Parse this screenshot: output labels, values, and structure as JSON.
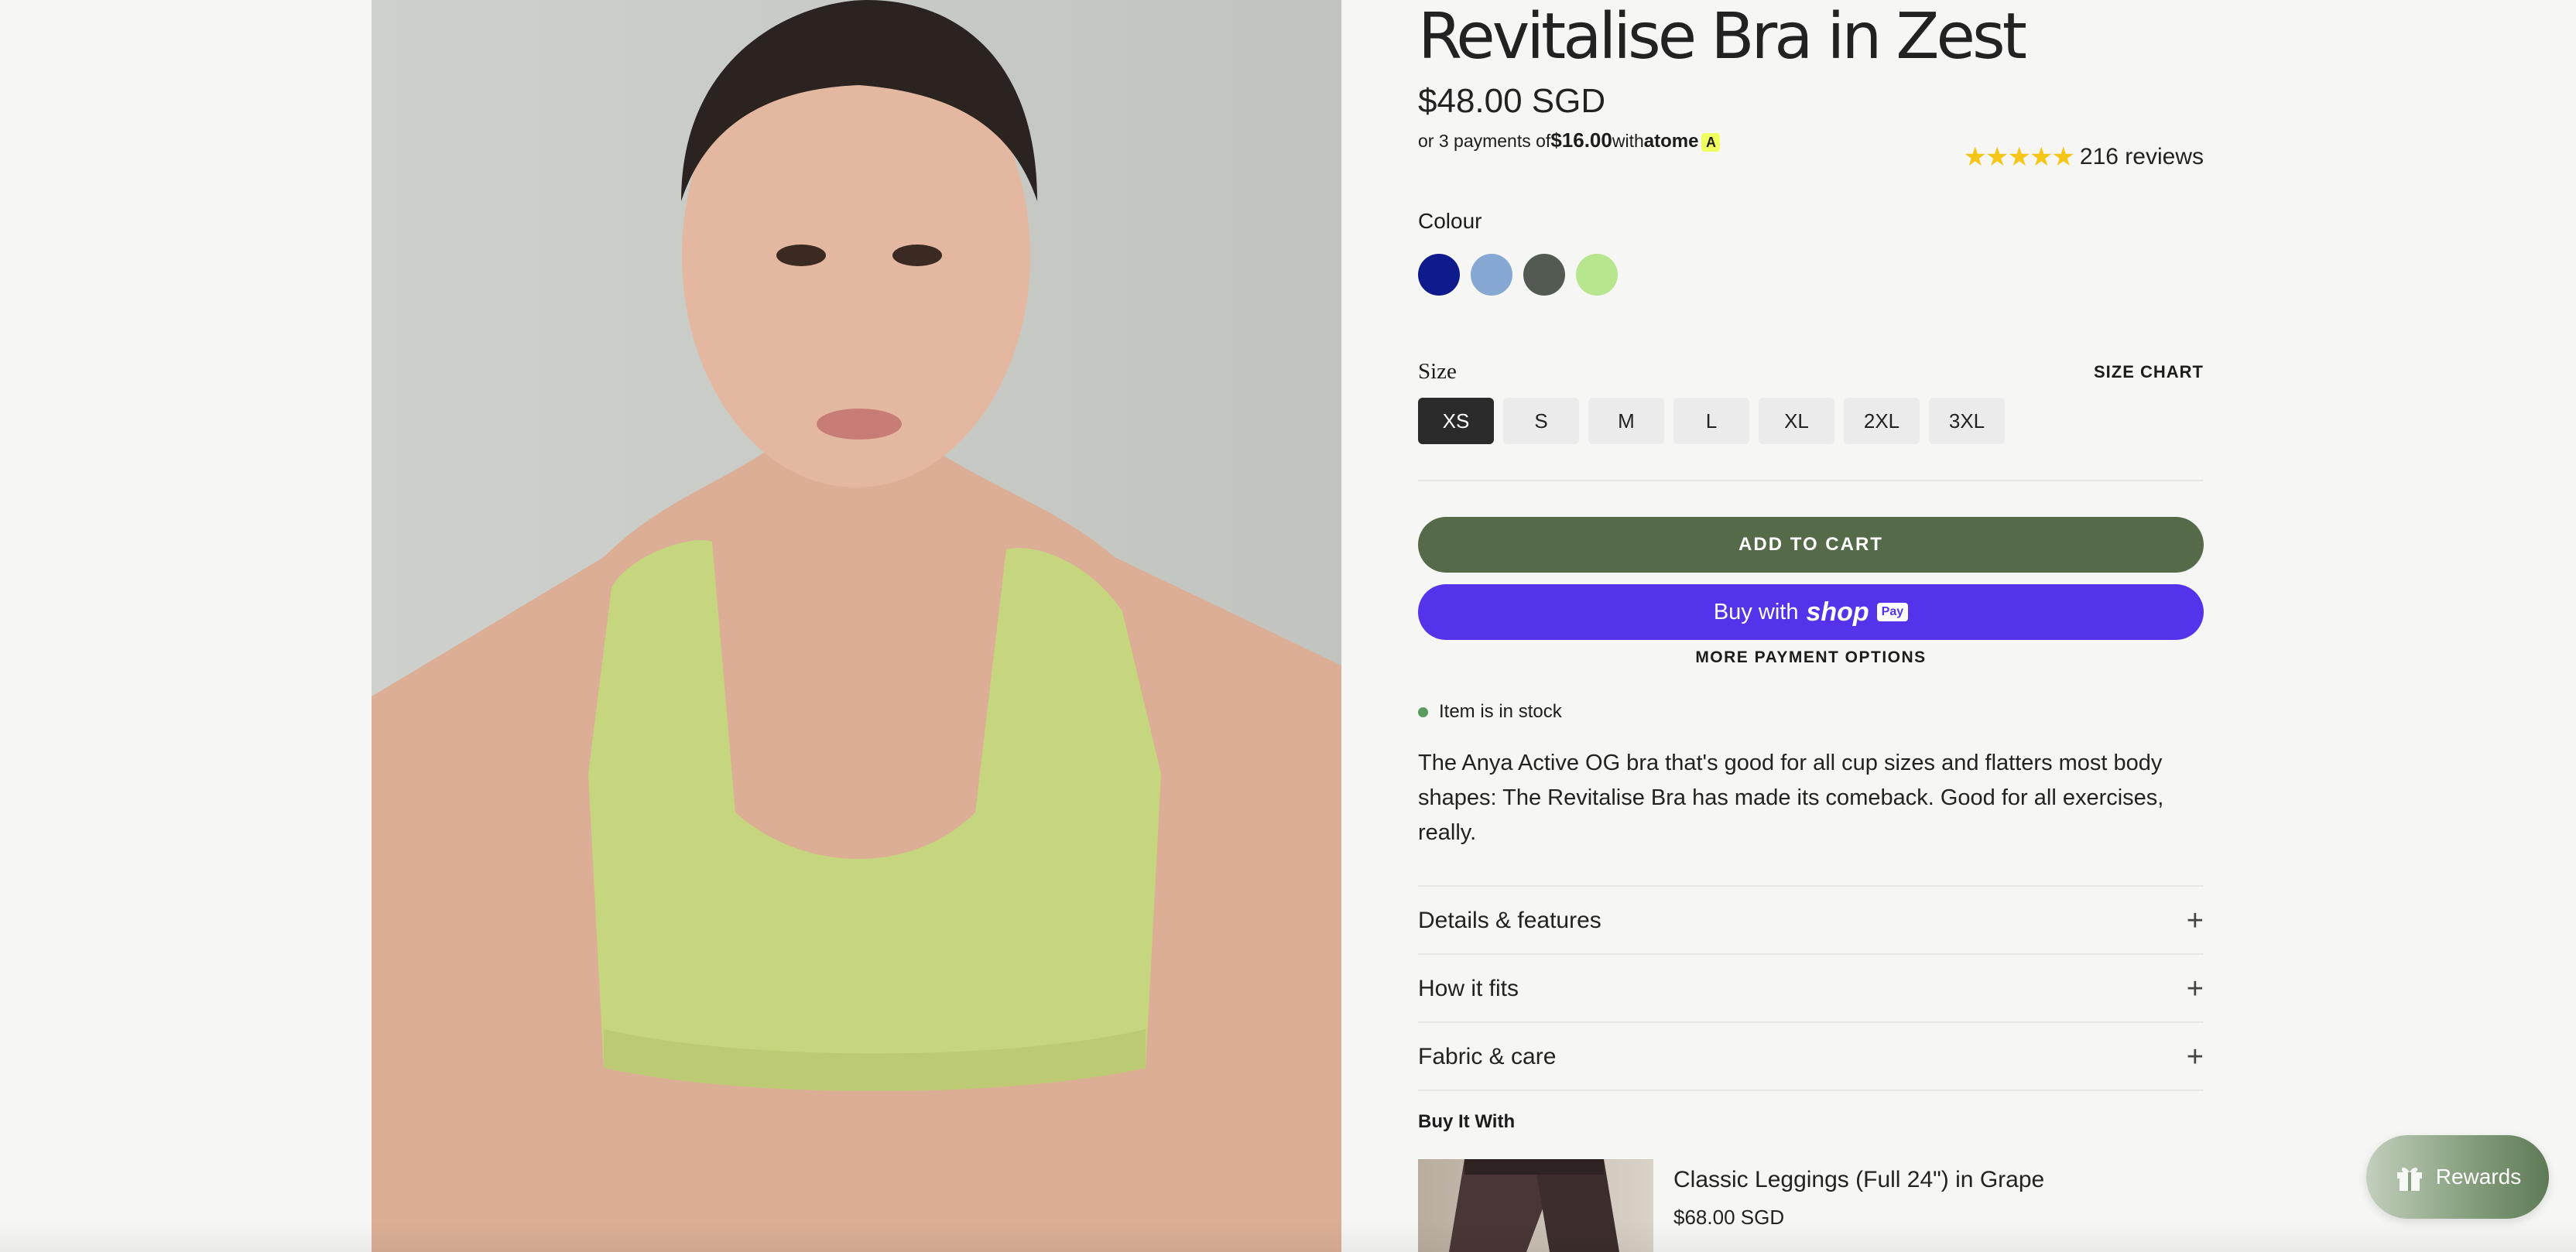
{
  "product": {
    "title": "Revitalise Bra in Zest",
    "price": "$48.00 SGD",
    "installment": {
      "prefix": "or 3 payments of",
      "amount": "$16.00",
      "with": "with",
      "provider": "atome",
      "provider_mark": "A"
    },
    "rating": {
      "stars": "★★★★★",
      "reviews": "216 reviews"
    },
    "colour": {
      "label": "Colour",
      "swatches": [
        "#0f1a8c",
        "#86a8d2",
        "#535a52",
        "#b7e68e"
      ]
    },
    "size": {
      "label": "Size",
      "chart_link": "SIZE CHART",
      "options": [
        "XS",
        "S",
        "M",
        "L",
        "XL",
        "2XL",
        "3XL"
      ],
      "selected": "XS"
    },
    "add_to_cart": "ADD TO CART",
    "buy_with": {
      "text": "Buy with",
      "logo": "shop",
      "badge": "Pay"
    },
    "more_payment": "MORE PAYMENT OPTIONS",
    "stock": "Item is in stock",
    "description": "The Anya Active OG bra that's good for all cup sizes and flatters most body shapes: The Revitalise Bra has made its comeback. Good for all exercises, really.",
    "accordions": [
      {
        "label": "Details & features",
        "icon": "+"
      },
      {
        "label": "How it fits",
        "icon": "+"
      },
      {
        "label": "Fabric & care",
        "icon": "+"
      }
    ],
    "buy_it_with": {
      "heading": "Buy It With",
      "item": {
        "name": "Classic Leggings (Full 24\") in Grape",
        "price": "$68.00 SGD"
      }
    }
  },
  "rewards": {
    "label": "Rewards",
    "icon": "gift-icon"
  },
  "colors": {
    "add_to_cart": "#546a48",
    "shop_pay": "#5433eb",
    "stars": "#f5c518",
    "stock_dot": "#5a9a5e"
  }
}
